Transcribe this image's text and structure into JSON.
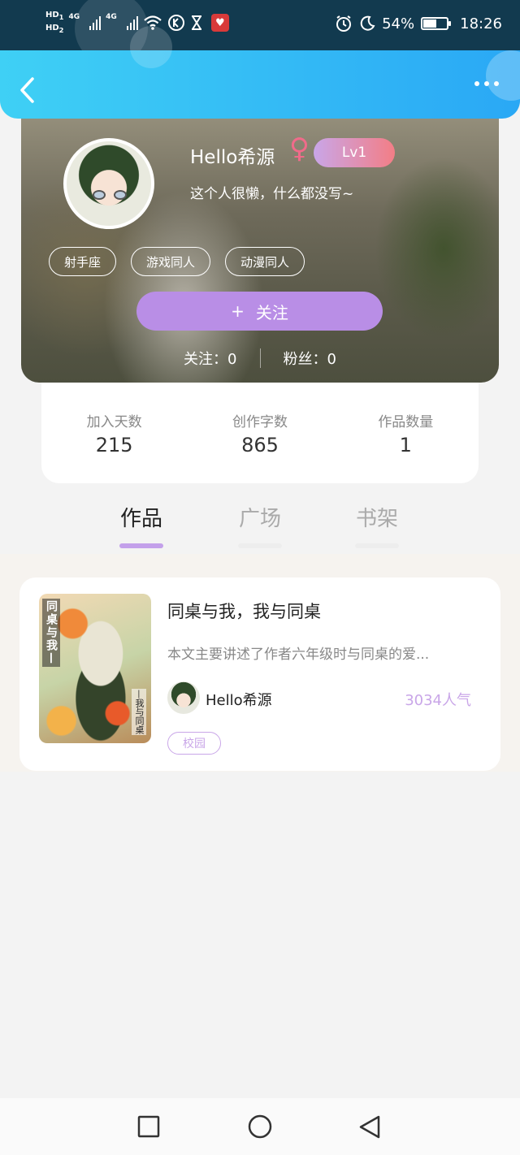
{
  "status_bar": {
    "hd1": "HD",
    "hd1_sub": "1",
    "hd2": "HD",
    "hd2_sub": "2",
    "net1": "4G",
    "net2": "4G",
    "battery_percent": "54%",
    "battery_level": 0.54,
    "time": "18:26",
    "icons": [
      "signal-icon",
      "wifi-icon",
      "k-app-icon",
      "hourglass-icon",
      "heart-app-icon",
      "alarm-icon",
      "moon-icon",
      "battery-icon"
    ]
  },
  "header": {
    "back_icon": "chevron-left-icon",
    "more_icon": "more-dots-icon"
  },
  "profile": {
    "nickname": "Hello希源",
    "gender_icon": "♀",
    "level": "Lv1",
    "signature": "这个人很懒，什么都没写~",
    "tags": [
      "射手座",
      "游戏同人",
      "动漫同人"
    ],
    "follow_plus": "+",
    "follow_label": "关注",
    "following_label": "关注：",
    "following_count": "0",
    "fans_label": "粉丝：",
    "fans_count": "0"
  },
  "stats": [
    {
      "label": "加入天数",
      "value": "215"
    },
    {
      "label": "创作字数",
      "value": "865"
    },
    {
      "label": "作品数量",
      "value": "1"
    }
  ],
  "tabs": [
    {
      "label": "作品",
      "active": true
    },
    {
      "label": "广场",
      "active": false
    },
    {
      "label": "书架",
      "active": false
    }
  ],
  "works": [
    {
      "cover_title": "同桌与我—",
      "cover_subtitle": "—我与同桌",
      "title": "同桌与我，我与同桌",
      "description": "本文主要讲述了作者六年级时与同桌的爱...",
      "author": "Hello希源",
      "popularity": "3034人气",
      "tag": "校园"
    }
  ],
  "colors": {
    "header_start": "#3fd0f5",
    "header_end": "#2aa8f5",
    "accent_purple": "#b98ee6",
    "tab_indicator": "#c3a0ea",
    "popularity": "#c9a6e8",
    "female_pink": "#f06b8a"
  },
  "nav": {
    "buttons": [
      "recents-square-icon",
      "home-circle-icon",
      "back-triangle-icon"
    ]
  }
}
